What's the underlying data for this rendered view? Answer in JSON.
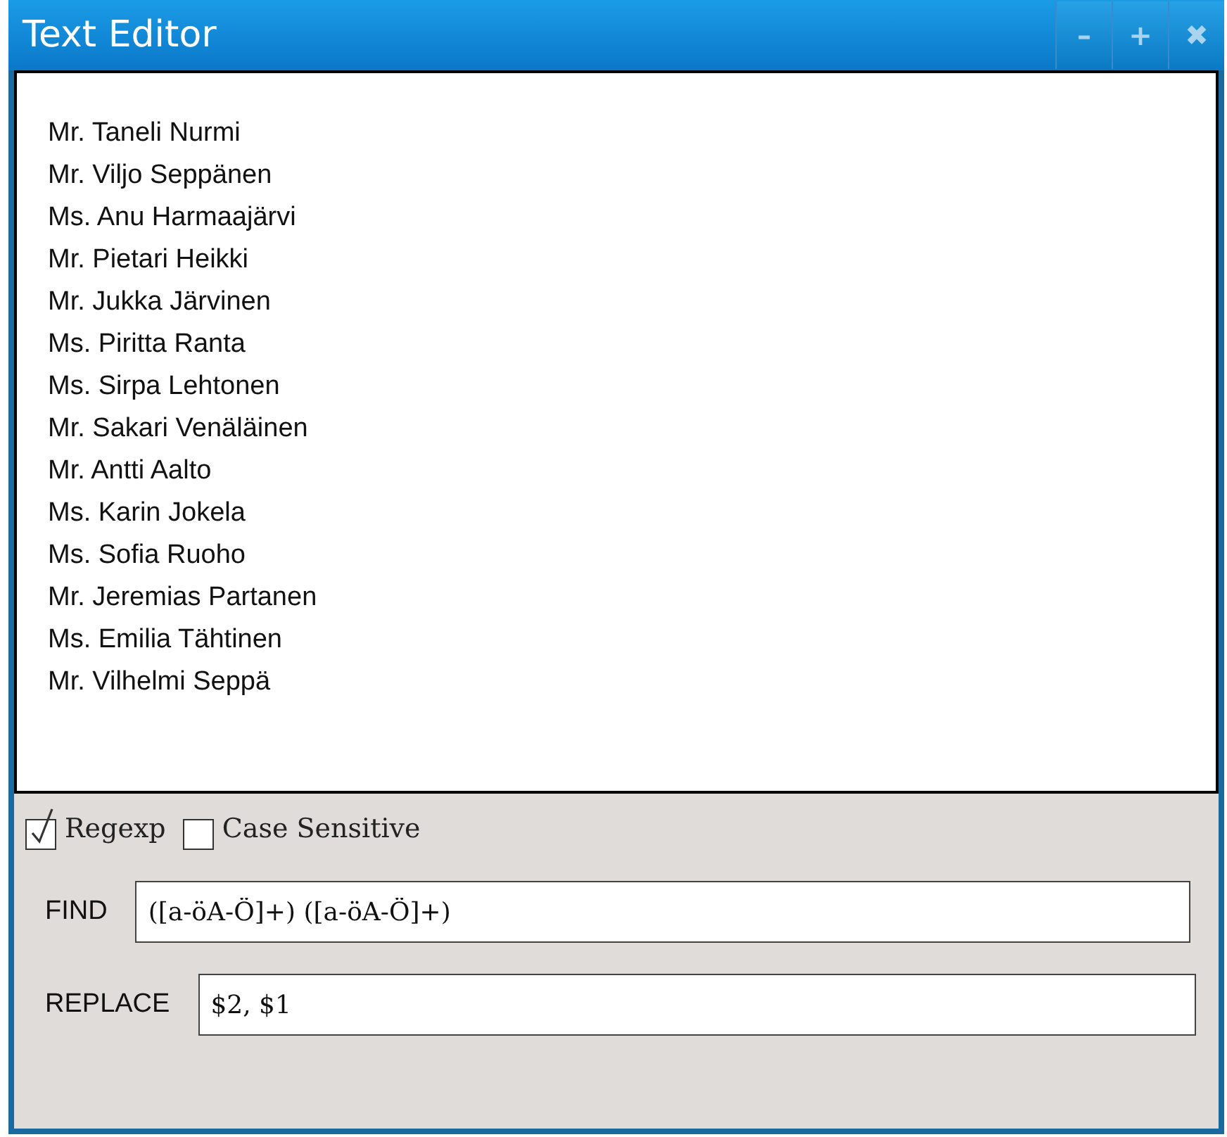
{
  "window": {
    "title": "Text Editor",
    "controls": [
      "–",
      "+",
      "✖"
    ]
  },
  "editor": {
    "lines": [
      "Mr. Taneli Nurmi",
      "Mr. Viljo Seppänen",
      "Ms. Anu Harmaajärvi",
      "Mr. Pietari Heikki",
      "Mr. Jukka Järvinen",
      "Ms. Piritta Ranta",
      "Ms. Sirpa Lehtonen",
      "Mr. Sakari Venäläinen",
      "Mr. Antti Aalto",
      "Ms. Karin Jokela",
      "Ms. Sofia Ruoho",
      "Mr. Jeremias Partanen",
      "Ms. Emilia Tähtinen",
      "Mr. Vilhelmi Seppä"
    ]
  },
  "options": [
    {
      "label": "Regexp",
      "checked": true
    },
    {
      "label": "Case Sensitive",
      "checked": false
    }
  ],
  "fields": [
    {
      "label": "FIND",
      "value": "([a-öA-Ö]+) ([a-öA-Ö]+)"
    },
    {
      "label": "REPLACE",
      "value": "$2, $1"
    }
  ]
}
